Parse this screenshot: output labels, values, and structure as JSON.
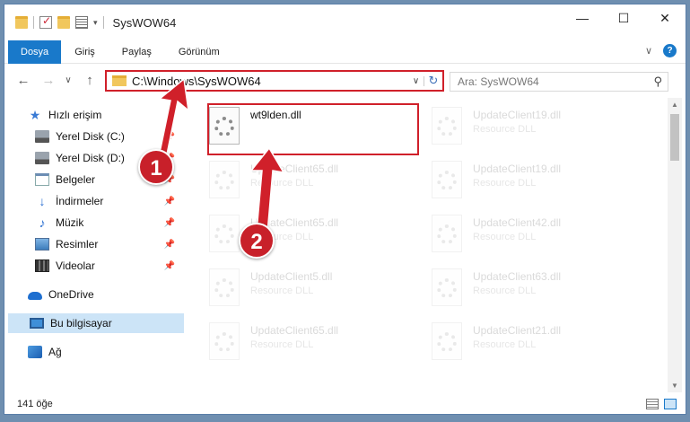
{
  "window": {
    "title": "SysWOW64"
  },
  "ribbon": {
    "tabs": [
      "Dosya",
      "Giriş",
      "Paylaş",
      "Görünüm"
    ]
  },
  "address": {
    "path": "C:\\Windows\\SysWOW64"
  },
  "search": {
    "placeholder": "Ara: SysWOW64"
  },
  "sidebar": {
    "items": [
      {
        "label": "Hızlı erişim",
        "icon": "star-icon"
      },
      {
        "label": "Yerel Disk (C:)",
        "icon": "drive-icon",
        "pinned": true
      },
      {
        "label": "Yerel Disk (D:)",
        "icon": "drive-icon",
        "pinned": true
      },
      {
        "label": "Belgeler",
        "icon": "documents-icon",
        "pinned": true
      },
      {
        "label": "İndirmeler",
        "icon": "download-icon",
        "pinned": true
      },
      {
        "label": "Müzik",
        "icon": "music-icon",
        "pinned": true
      },
      {
        "label": "Resimler",
        "icon": "pictures-icon",
        "pinned": true
      },
      {
        "label": "Videolar",
        "icon": "videos-icon",
        "pinned": true
      },
      {
        "label": "OneDrive",
        "icon": "onedrive-icon"
      },
      {
        "label": "Bu bilgisayar",
        "icon": "this-pc-icon",
        "selected": true
      },
      {
        "label": "Ağ",
        "icon": "network-icon"
      }
    ]
  },
  "files": [
    {
      "name": "wt9lden.dll",
      "type": "",
      "highlighted": true
    },
    {
      "name": "UpdateClient19.dll",
      "type": "Resource DLL"
    },
    {
      "name": "UpdateClient65.dll",
      "type": "Resource DLL"
    },
    {
      "name": "UpdateClient19.dll",
      "type": "Resource DLL"
    },
    {
      "name": "UpdateClient65.dll",
      "type": "Resource DLL"
    },
    {
      "name": "UpdateClient42.dll",
      "type": "Resource DLL"
    },
    {
      "name": "UpdateClient5.dll",
      "type": "Resource DLL"
    },
    {
      "name": "UpdateClient63.dll",
      "type": "Resource DLL"
    },
    {
      "name": "UpdateClient65.dll",
      "type": "Resource DLL"
    },
    {
      "name": "UpdateClient21.dll",
      "type": "Resource DLL"
    }
  ],
  "markers": [
    "1",
    "2"
  ],
  "status": {
    "count": "141 öğe"
  },
  "colors": {
    "accent": "#1979ca",
    "highlight": "#d0202a"
  }
}
